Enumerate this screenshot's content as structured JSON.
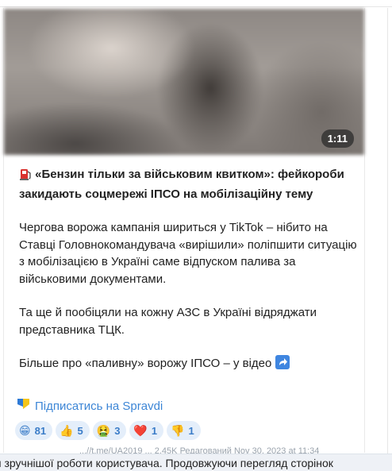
{
  "video": {
    "duration": "1:11"
  },
  "post": {
    "headline_lead": "«Бензин тільки за військовим квитком»: фейкороби закидають соцмережі ІПСО на мобілізаційну тему",
    "para1": "Чергова ворожа кампанія шириться у TikTok – нібито на Ставці Головнокомандувача «вирішили» поліпшити ситуацію з мобілізацією в Україні саме відпуском палива за військовими документами.",
    "para2": "Та ще й пообіцяли на кожну АЗС в Україні відряджати представника ТЦК.",
    "para3": "Більше про «паливну» ворожу ІПСО – у відео",
    "subscribe_label": "Підписатись на Spravdi",
    "meta": "...//t.me/UA2019 ...   2,45K  Редагований  Nov 30, 2023 at 11:34"
  },
  "reactions": [
    {
      "emoji": "😁",
      "count": "81"
    },
    {
      "emoji": "👍",
      "count": "5"
    },
    {
      "emoji": "🤮",
      "count": "3"
    },
    {
      "emoji": "❤️",
      "count": "1"
    },
    {
      "emoji": "👎",
      "count": "1"
    }
  ],
  "cookie_banner": {
    "text": "я зручнішої роботи користувача. Продовжуючи перегляд сторінок"
  },
  "colors": {
    "link": "#3d86d6",
    "reaction_bg": "#e4eefa",
    "reaction_text": "#3a7cc8"
  }
}
